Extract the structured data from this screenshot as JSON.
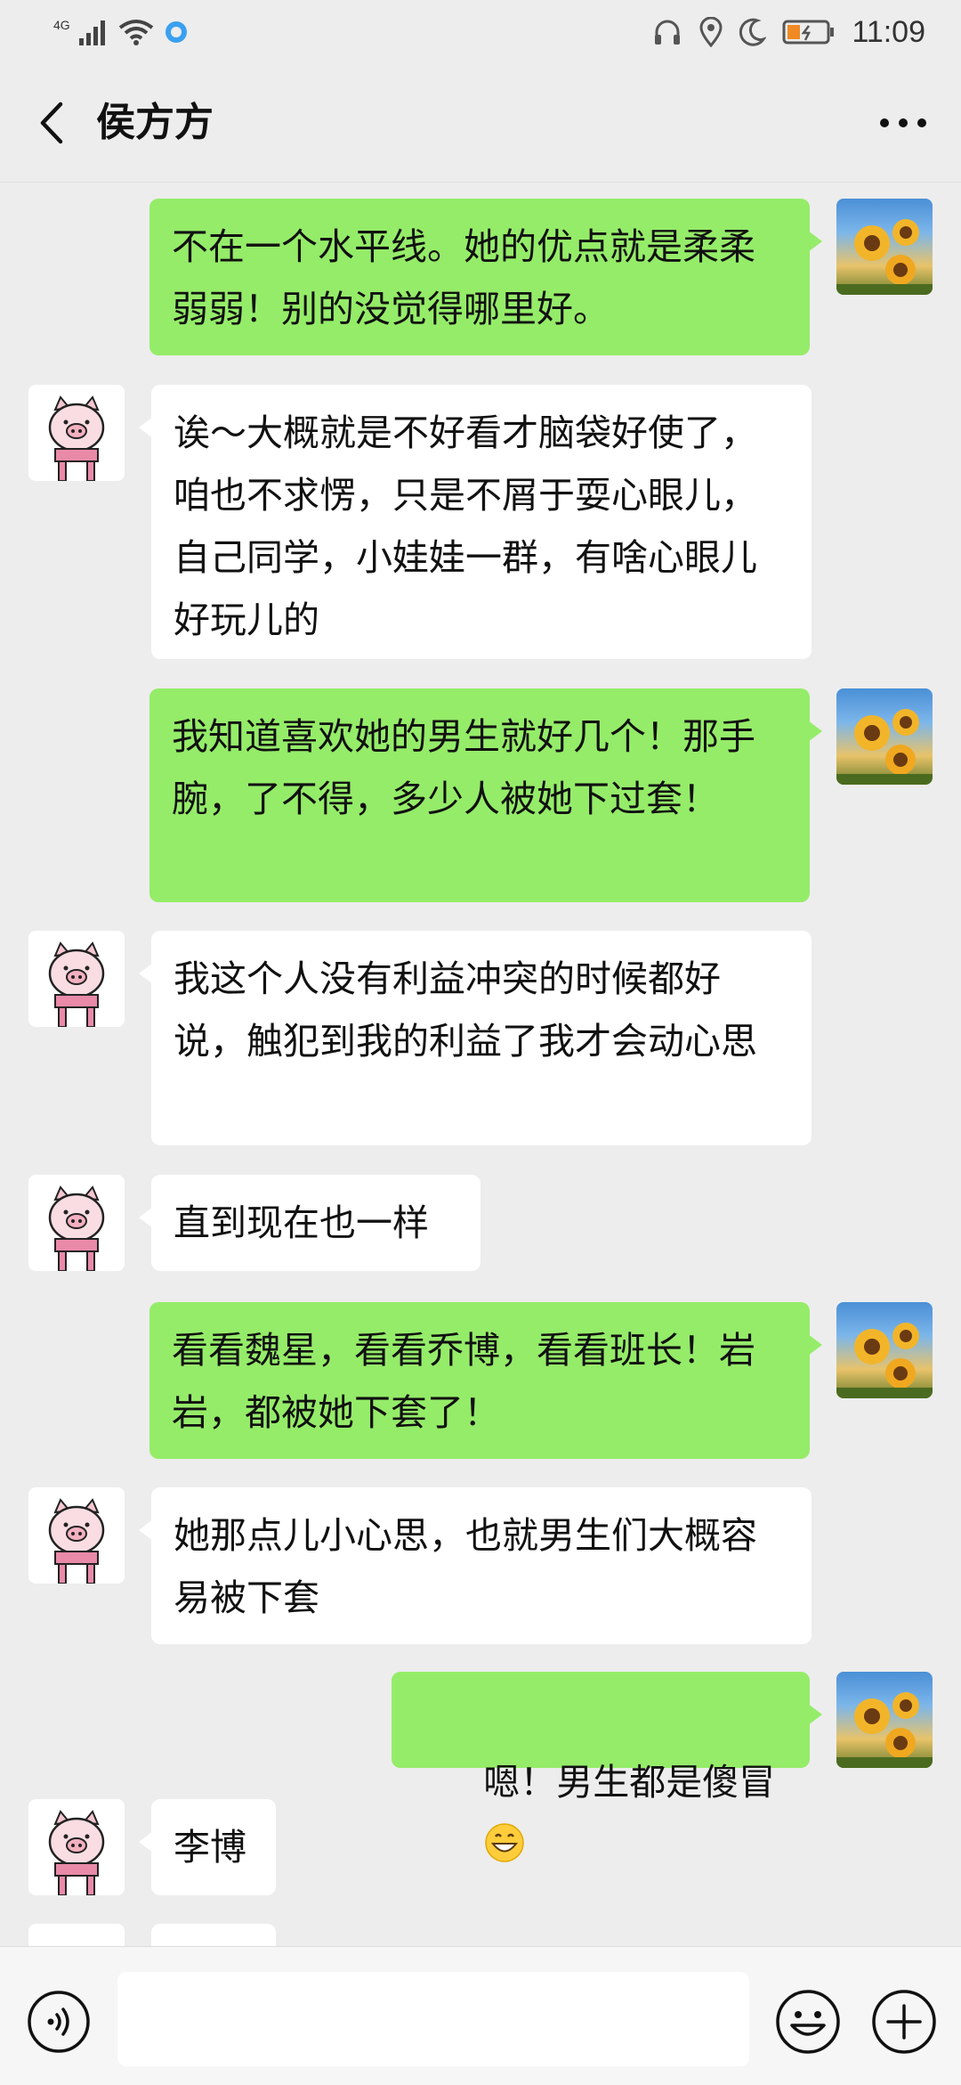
{
  "status_bar": {
    "network": "4G",
    "time": "11:09",
    "icons": [
      "signal-icon",
      "wifi-icon",
      "browser-app-icon",
      "headphones-icon",
      "location-icon",
      "moon-icon",
      "battery-icon"
    ]
  },
  "header": {
    "title": "侯方方",
    "back_icon": "chevron-left-icon",
    "more_icon": "more-icon"
  },
  "messages": [
    {
      "side": "me",
      "avatar": "sunflower-avatar",
      "text": "不在一个水平线。她的优点就是柔柔弱弱！别的没觉得哪里好。"
    },
    {
      "side": "them",
      "avatar": "pig-avatar",
      "text": "诶～大概就是不好看才脑袋好使了，咱也不求愣，只是不屑于耍心眼儿，自己同学，小娃娃一群，有啥心眼儿好玩儿的"
    },
    {
      "side": "me",
      "avatar": "sunflower-avatar",
      "text": "我知道喜欢她的男生就好几个！那手腕，了不得，多少人被她下过套！"
    },
    {
      "side": "them",
      "avatar": "pig-avatar",
      "text": "我这个人没有利益冲突的时候都好说，触犯到我的利益了我才会动心思"
    },
    {
      "side": "them",
      "avatar": "pig-avatar",
      "text": "直到现在也一样"
    },
    {
      "side": "me",
      "avatar": "sunflower-avatar",
      "text": "看看魏星，看看乔博，看看班长！岩岩，都被她下套了！"
    },
    {
      "side": "them",
      "avatar": "pig-avatar",
      "text": "她那点儿小心思，也就男生们大概容易被下套"
    },
    {
      "side": "me",
      "avatar": "sunflower-avatar",
      "text": "嗯！男生都是傻冒",
      "emoji": "grinning-face-emoji"
    },
    {
      "side": "them",
      "avatar": "pig-avatar",
      "text": "李博"
    }
  ],
  "input_bar": {
    "voice_icon": "voice-icon",
    "input_value": "",
    "emoji_icon": "emoji-icon",
    "plus_icon": "plus-icon"
  },
  "colors": {
    "background": "#ededed",
    "my_bubble": "#95ec69",
    "their_bubble": "#ffffff"
  }
}
